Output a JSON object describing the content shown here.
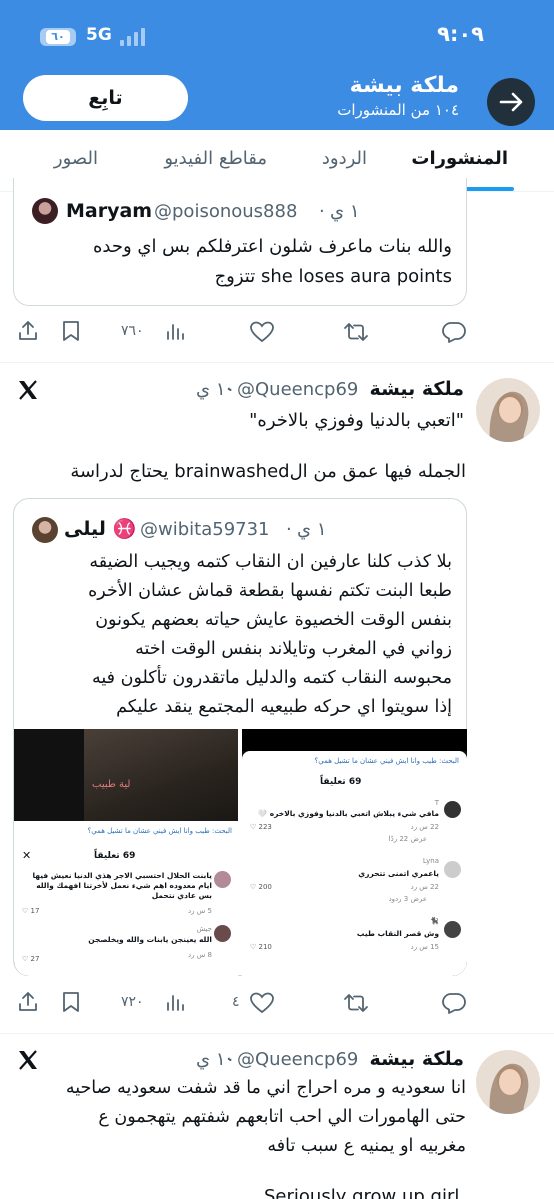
{
  "status_bar": {
    "time": "٩:٠٩",
    "battery": "٦٠",
    "network": "5G"
  },
  "header": {
    "name": "ملكة بيشة",
    "post_count": "١٠٤ من المنشورات",
    "follow_label": "تابِع"
  },
  "tabs": [
    {
      "label": "المنشورات",
      "active": true
    },
    {
      "label": "الردود",
      "active": false
    },
    {
      "label": "مقاطع الفيديو",
      "active": false
    },
    {
      "label": "الصور",
      "active": false
    }
  ],
  "post1": {
    "quoted": {
      "name": "Maryam",
      "handle": "@poisonous888",
      "time": "١ ي",
      "line1": "والله بنات ماعرف شلون اعترفلكم بس اي وحده",
      "line2": "she loses aura points تتزوج"
    },
    "views": "٧٦٠"
  },
  "post2": {
    "name": "ملكة بيشة",
    "handle": "@Queencp69",
    "time": "١٠ ي",
    "quote_line": "\"اتعبي بالدنيا وفوزي بالاخره\"",
    "body": "الجمله فيها عمق من الbrainwashed يحتاج لدراسة",
    "quoted": {
      "name": "ليلى ♓️",
      "handle": "@wibita59731",
      "time": "١ ي",
      "lines": [
        "بلا كذب كلنا عارفين ان النقاب كتمه ويجيب الضيقه",
        "طبعا البنت تكتم نفسها بقطعة قماش عشان الأخره",
        "بنفس الوقت الخصيوة عايش حياته بعضهم يكونون",
        "زواني في المغرب وتايلاند بنفس الوقت اخته",
        "محبوسه النقاب كتمه والدليل ماتقدرون تأكلون فيه",
        "إذا سويتوا اي حركه طبيعيه المجتمع ينقد عليكم"
      ],
      "left_image": {
        "overlay_text": "لية طبيب",
        "search_label": "البحث: طيب وانا ايش فيني عشان ما تشيل همي؟",
        "count": "69 تعليقاً",
        "comment1": "يابنت الحلال احتسبي الاجر هذي الدنيا نعيش فيها ايام معدوده اهم شيء نعمل لأخرتنا افهمك والله بس عادي نتحمل",
        "comment1_meta": "5 س  رد",
        "comment1_likes": "17",
        "comment2_name": "جيش",
        "comment2": "الله يعينجن يابنات والله ويخلصجن",
        "comment2_meta": "8 س  رد",
        "comment2_likes": "27"
      },
      "right_image": {
        "search_label": "البحث: طيب وانا ايش فيني عشان ما تشيل همي؟",
        "count": "69 تعليقاً",
        "c1_name": "T",
        "c1_text": "مافي شيء يبلاش اتعبي بالدنيا وفوزي بالاخره 🤍",
        "c1_meta": "22 س  رد",
        "c1_likes": "223",
        "c1_replies": "عرض 22 ردًا",
        "c2_name": "Lyna",
        "c2_text": "ياعمري اتمنى تتحرري",
        "c2_meta": "22 س  رد",
        "c2_likes": "200",
        "c2_replies": "عرض 3 ردود",
        "c3_name": "🐈‍⬛",
        "c3_text": "وش قصر النقاب طيب",
        "c3_meta": "15 س  رد",
        "c3_likes": "210"
      }
    },
    "views": "٧٢٠",
    "likes": "٤"
  },
  "post3": {
    "name": "ملكة بيشة",
    "handle": "@Queencp69",
    "time": "١٠ ي",
    "lines": [
      "انا سعوديه و مره احراج اني ما قد شفت سعوديه صاحيه",
      "حتى الهامورات الي احب اتابعهم شفتهم يتهجمون ع",
      "مغربيه او يمنيه ع سبب تافه"
    ],
    "trailing": "Seriously grow up girl"
  },
  "colors": {
    "header_bg": "#3d8ce3",
    "accent": "#1d9bf0",
    "text": "#0f1419",
    "muted": "#536471",
    "border": "#cfd9de"
  },
  "icons": [
    "share-icon",
    "bookmark-icon",
    "views-icon",
    "heart-icon",
    "retweet-icon",
    "reply-icon",
    "x-logo-icon",
    "back-arrow-icon"
  ]
}
